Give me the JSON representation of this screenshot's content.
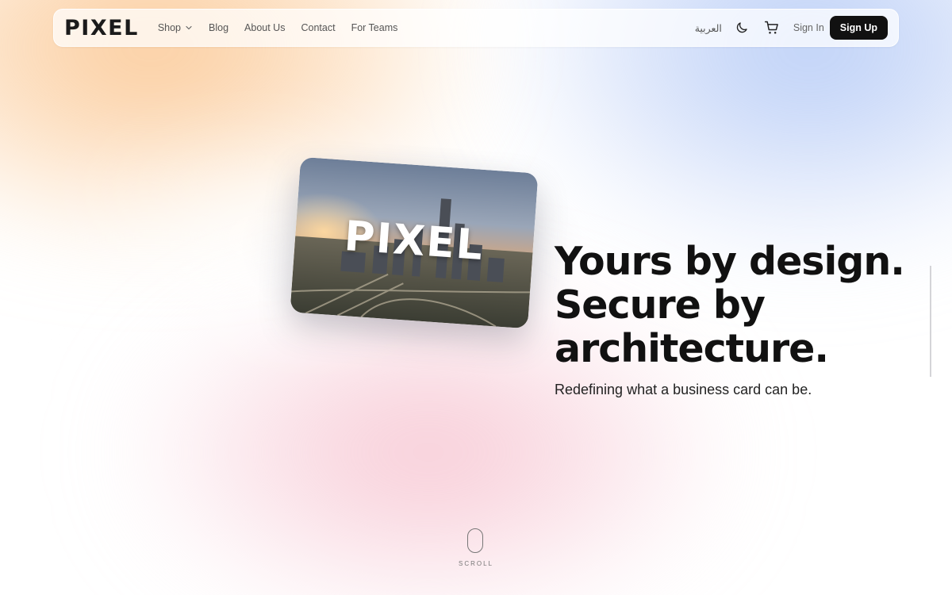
{
  "brand": {
    "logo": "PIXEL"
  },
  "nav": {
    "links": [
      {
        "label": "Shop",
        "has_dropdown": true
      },
      {
        "label": "Blog"
      },
      {
        "label": "About Us"
      },
      {
        "label": "Contact"
      },
      {
        "label": "For Teams"
      }
    ],
    "language": "العربية",
    "icons": [
      "moon-icon",
      "cart-icon"
    ],
    "sign_in": "Sign In",
    "sign_up": "Sign Up"
  },
  "hero": {
    "card_text": "PIXEL",
    "headline_line1": "Yours by design.",
    "headline_line2": "Secure by",
    "headline_line3": "architecture.",
    "subtitle": "Redefining what a business card can be."
  },
  "scroll": {
    "label": "SCROLL"
  },
  "colors": {
    "primary_button": "#111111",
    "text": "#111111",
    "peach": "#FABE82",
    "blue": "#AAC3F5",
    "pink": "#F5B9C8"
  }
}
